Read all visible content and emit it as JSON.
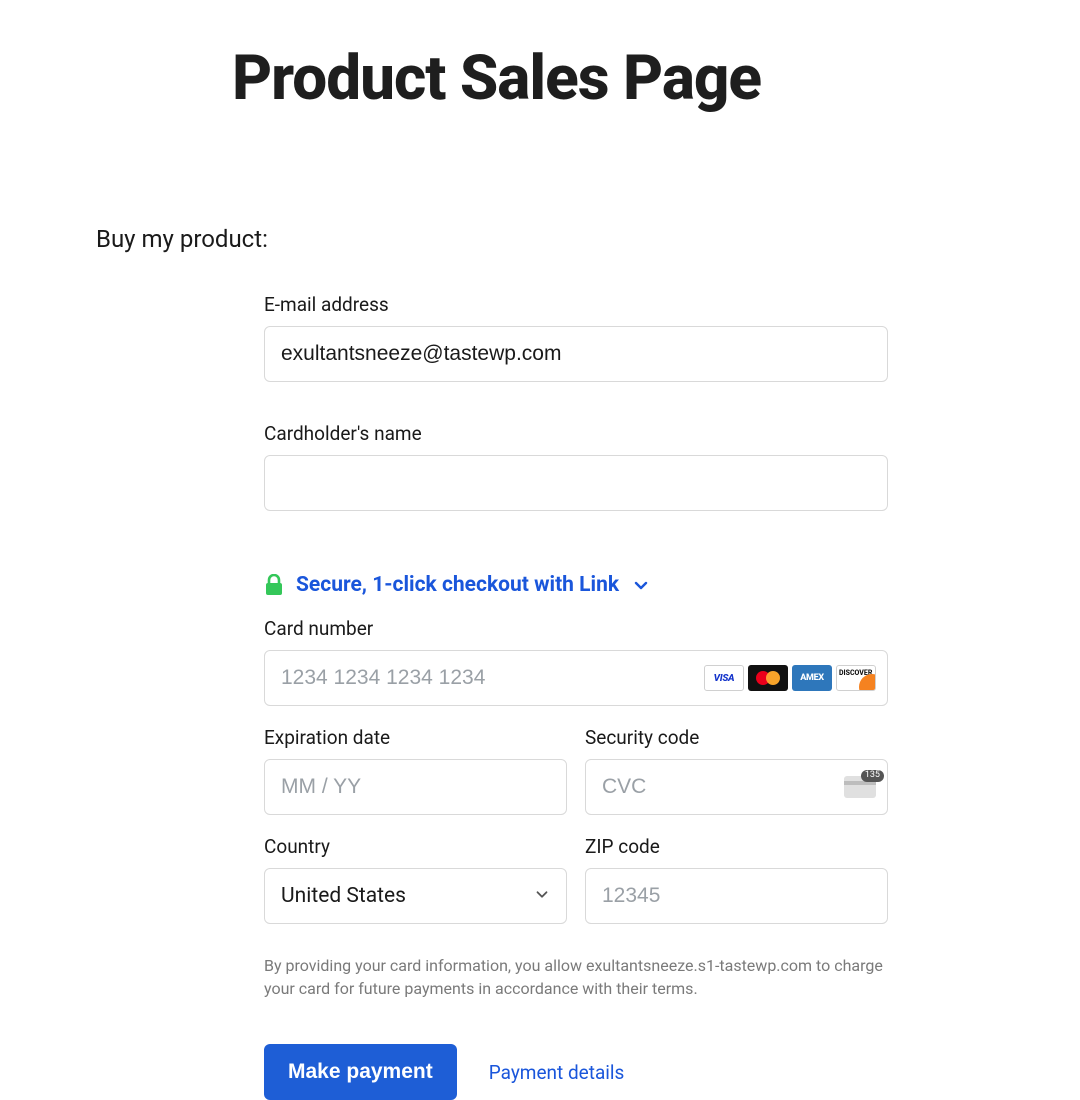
{
  "page": {
    "title": "Product Sales Page",
    "intro": "Buy my product:"
  },
  "form": {
    "email_label": "E-mail address",
    "email_value": "exultantsneeze@tastewp.com",
    "cardholder_label": "Cardholder's name",
    "cardholder_value": "",
    "secure_link_text": "Secure, 1-click checkout with Link",
    "card_number_label": "Card number",
    "card_number_placeholder": "1234 1234 1234 1234",
    "card_brands": {
      "visa": "VISA",
      "amex": "AMEX",
      "discover": "DISCOVER"
    },
    "exp_label": "Expiration date",
    "exp_placeholder": "MM / YY",
    "cvc_label": "Security code",
    "cvc_placeholder": "CVC",
    "cvc_badge": "135",
    "country_label": "Country",
    "country_value": "United States",
    "zip_label": "ZIP code",
    "zip_placeholder": "12345",
    "disclaimer": "By providing your card information, you allow exultantsneeze.s1-tastewp.com to charge your card for future payments in accordance with their terms."
  },
  "actions": {
    "submit_label": "Make payment",
    "details_link": "Payment details"
  }
}
